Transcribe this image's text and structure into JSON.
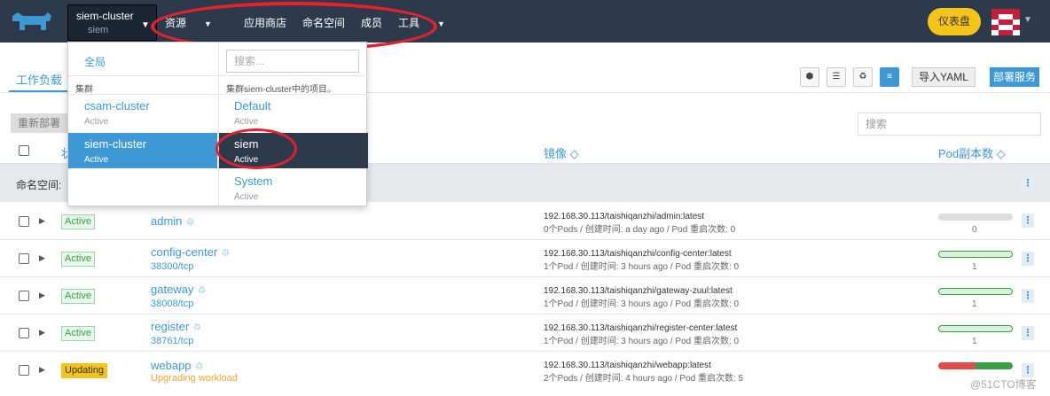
{
  "header": {
    "cluster": "siem-cluster",
    "project": "siem",
    "nav": [
      "资源",
      "应用商店",
      "命名空间",
      "成员",
      "工具"
    ],
    "dashboard_btn": "仪表盘"
  },
  "tabs": {
    "active": "工作负载"
  },
  "toolbar": {
    "import_yaml": "导入YAML",
    "deploy": "部署服务",
    "redeploy": "重新部署",
    "search_placeholder": "搜索"
  },
  "table": {
    "col_status": "状",
    "col_image": "镜像",
    "col_pods": "Pod副本数",
    "namespace_label": "命名空间:",
    "rows": [
      {
        "status": "Active",
        "name": "admin",
        "port": "",
        "image": "192.168.30.113/taishiqanzhi/admin:latest",
        "meta": "0个Pods / 创建时间: a day ago / Pod 重启次数: 0",
        "count": "0"
      },
      {
        "status": "Active",
        "name": "config-center",
        "port": "38300/tcp",
        "image": "192.168.30.113/taishiqanzhi/config-center:latest",
        "meta": "1个Pod / 创建时间: 3 hours ago / Pod 重启次数: 0",
        "count": "1"
      },
      {
        "status": "Active",
        "name": "gateway",
        "port": "38008/tcp",
        "image": "192.168.30.113/taishiqanzhi/gateway-zuul:latest",
        "meta": "1个Pod / 创建时间: 3 hours ago / Pod 重启次数: 0",
        "count": "1"
      },
      {
        "status": "Active",
        "name": "register",
        "port": "38761/tcp",
        "image": "192.168.30.113/taishiqanzhi/register-center:latest",
        "meta": "1个Pod / 创建时间: 3 hours ago / Pod 重启次数: 0",
        "count": "1"
      },
      {
        "status": "Updating",
        "name": "webapp",
        "port": "Upgrading workload",
        "image": "192.168.30.113/taishiqanzhi/webapp:latest",
        "meta": "2个Pods / 创建时间: 4 hours ago / Pod 重启次数: 5",
        "count": ""
      }
    ]
  },
  "dropdown": {
    "global": "全局",
    "search_placeholder": "搜索...",
    "clusters_label": "集群",
    "projects_label": "集群siem-cluster中的项目。",
    "clusters": [
      {
        "name": "csam-cluster",
        "state": "Active"
      },
      {
        "name": "siem-cluster",
        "state": "Active"
      }
    ],
    "projects": [
      {
        "name": "Default",
        "state": "Active"
      },
      {
        "name": "siem",
        "state": "Active"
      },
      {
        "name": "System",
        "state": "Active"
      }
    ]
  },
  "watermark": "@51CTO博客"
}
